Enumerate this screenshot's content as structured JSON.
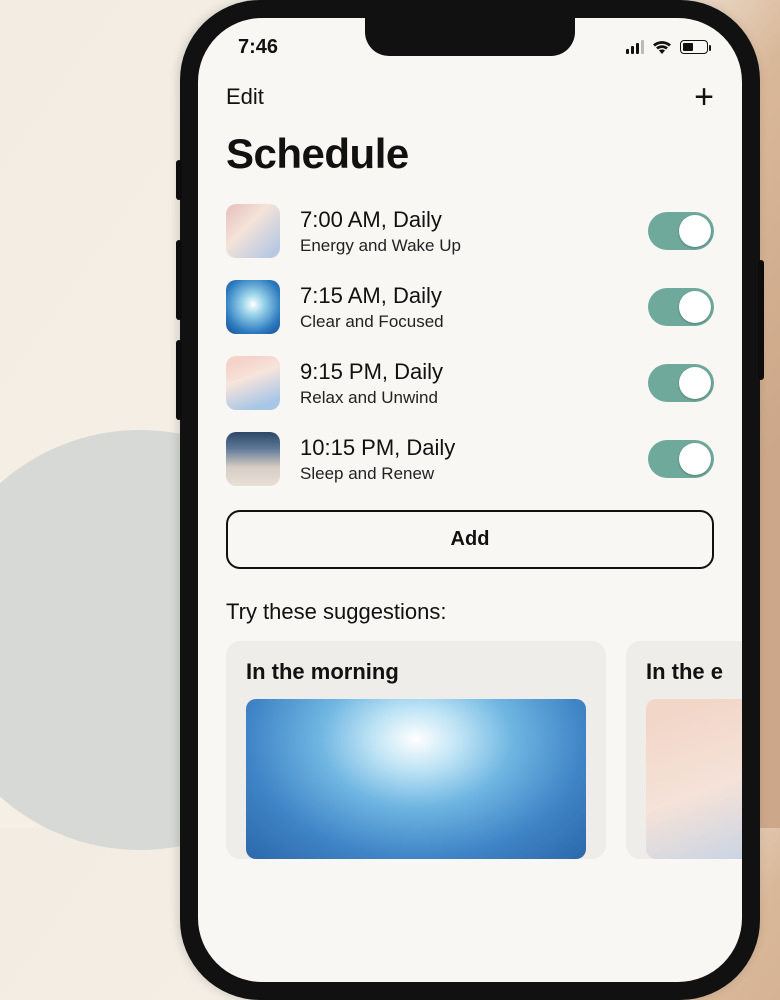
{
  "status": {
    "time": "7:46"
  },
  "nav": {
    "edit_label": "Edit",
    "plus_label": "+"
  },
  "page_title": "Schedule",
  "schedule": [
    {
      "time": "7:00 AM, Daily",
      "subtitle": "Energy and Wake Up",
      "enabled": true,
      "thumb": "thumb-1"
    },
    {
      "time": "7:15 AM, Daily",
      "subtitle": "Clear and Focused",
      "enabled": true,
      "thumb": "thumb-2"
    },
    {
      "time": "9:15 PM, Daily",
      "subtitle": "Relax and Unwind",
      "enabled": true,
      "thumb": "thumb-3"
    },
    {
      "time": "10:15 PM, Daily",
      "subtitle": "Sleep and Renew",
      "enabled": true,
      "thumb": "thumb-4"
    }
  ],
  "add_button_label": "Add",
  "suggestions_heading": "Try these suggestions:",
  "suggestions": [
    {
      "title": "In the morning",
      "img": "sugg-1"
    },
    {
      "title": "In the e",
      "img": "sugg-2"
    }
  ],
  "colors": {
    "toggle_on": "#6fa99c",
    "screen_bg": "#f8f7f4"
  }
}
